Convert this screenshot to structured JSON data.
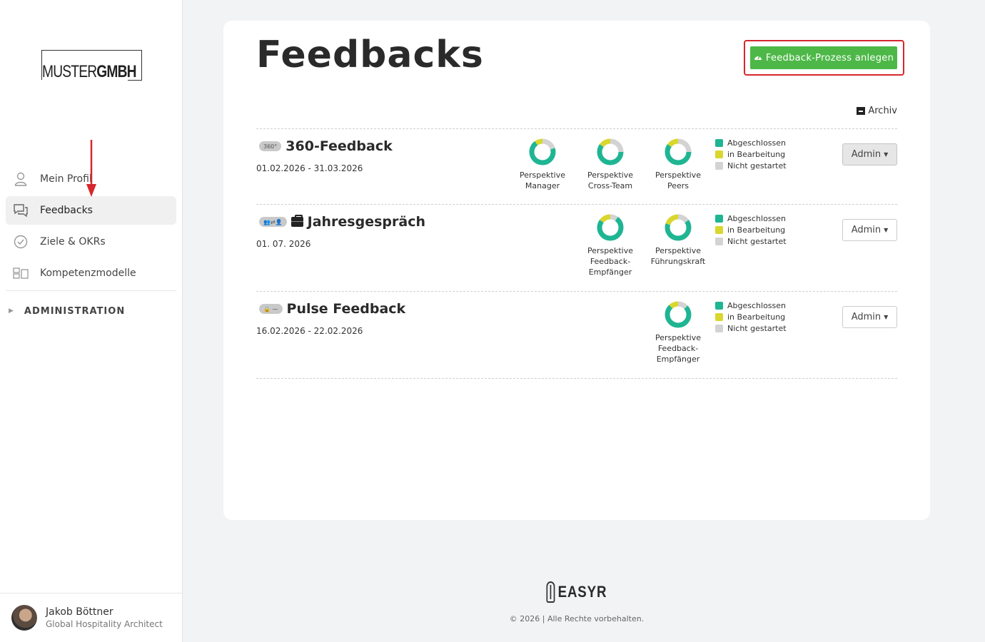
{
  "sidebar": {
    "logo": {
      "part1": "MUSTER",
      "part2": "GMBH"
    },
    "items": [
      {
        "label": "Mein Profil",
        "icon": "user-icon"
      },
      {
        "label": "Feedbacks",
        "icon": "chat-icon",
        "active": true
      },
      {
        "label": "Ziele & OKRs",
        "icon": "check-circle-icon"
      },
      {
        "label": "Kompetenzmodelle",
        "icon": "blocks-icon"
      }
    ],
    "admin_label": "ADMINISTRATION",
    "user": {
      "name": "Jakob Böttner",
      "role": "Global Hospitality Architect"
    }
  },
  "main": {
    "title": "Feedbacks",
    "create_label": "Feedback-Prozess anlegen",
    "archive_label": "Archiv",
    "colors": {
      "done": "#1fb593",
      "in_progress": "#d9d62e",
      "not_started": "#d3d3d3",
      "create_button": "#4db848",
      "highlight": "#d6262e"
    },
    "legend": {
      "done": "Abgeschlossen",
      "in_progress": "in Bearbeitung",
      "not_started": "Nicht gestartet"
    },
    "admin_label": "Admin",
    "processes": [
      {
        "badge": "360°",
        "title": "360-Feedback",
        "date": "01.02.2026 - 31.03.2026",
        "perspectives": [
          {
            "label": "Perspektive\nManager",
            "done": 0.7,
            "in_progress": 0.1,
            "not_started": 0.2
          },
          {
            "label": "Perspektive\nCross-Team",
            "done": 0.6,
            "in_progress": 0.15,
            "not_started": 0.25
          },
          {
            "label": "Perspektive\nPeers",
            "done": 0.6,
            "in_progress": 0.15,
            "not_started": 0.25
          }
        ]
      },
      {
        "badge": "👥⇄👤",
        "title": "Jahresgespräch",
        "date": "01. 07. 2026",
        "perspectives": [
          {
            "label": "Perspektive\nFeedback-\nEmpfänger",
            "done": 0.75,
            "in_progress": 0.15,
            "not_started": 0.1
          },
          {
            "label": "Perspektive\nFührungskraft",
            "done": 0.65,
            "in_progress": 0.2,
            "not_started": 0.15
          }
        ]
      },
      {
        "badge": "🔒 ⁓",
        "title": "Pulse Feedback",
        "date": "16.02.2026 - 22.02.2026",
        "perspectives": [
          {
            "label": "Perspektive\nFeedback-\nEmpfänger",
            "done": 0.75,
            "in_progress": 0.12,
            "not_started": 0.13
          }
        ]
      }
    ]
  },
  "footer": {
    "brand": "EASYR",
    "copyright": "© 2026 | Alle Rechte vorbehalten."
  }
}
